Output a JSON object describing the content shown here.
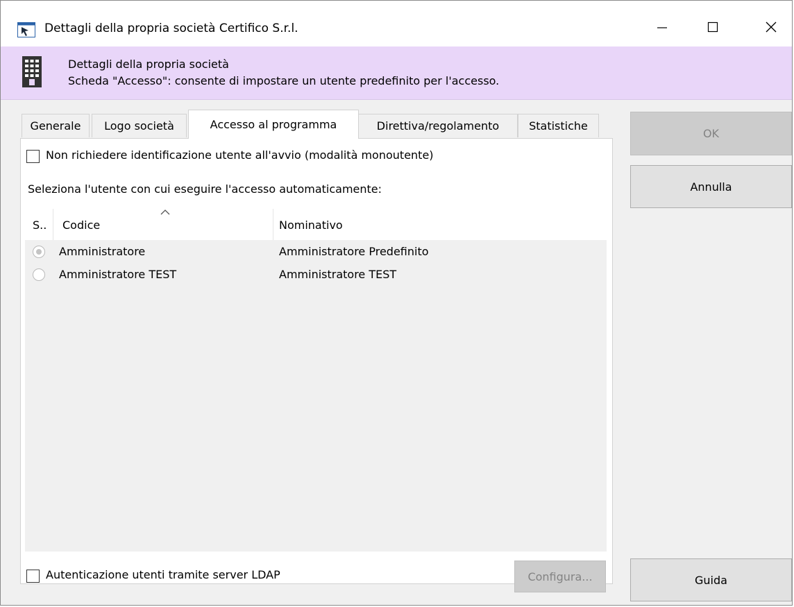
{
  "window": {
    "title": "Dettagli della propria società Certifico S.r.l.",
    "controls": {
      "minimize": "—",
      "maximize": "☐",
      "close": "✕"
    }
  },
  "banner": {
    "heading": "Dettagli della propria società",
    "description": "Scheda \"Accesso\": consente di impostare un utente predefinito per l'accesso.",
    "background": "#e9d6f9"
  },
  "tabs": [
    {
      "label": "Generale"
    },
    {
      "label": "Logo società"
    },
    {
      "label": "Accesso al programma",
      "active": true
    },
    {
      "label": "Direttiva/regolamento"
    },
    {
      "label": "Statistiche"
    }
  ],
  "access": {
    "single_user_label": "Non richiedere identificazione utente all'avvio (modalità monoutente)",
    "single_user_checked": false,
    "select_user_label": "Seleziona l'utente con cui eseguire l'accesso automaticamente:",
    "columns": [
      "S..",
      "Codice",
      "Nominativo"
    ],
    "users": [
      {
        "code": "Amministratore",
        "name": "Amministratore Predefinito",
        "selected": true
      },
      {
        "code": "Amministratore TEST",
        "name": "Amministratore TEST",
        "selected": false
      }
    ],
    "ldap_label": "Autenticazione utenti tramite server LDAP",
    "ldap_checked": false,
    "configure_button": "Configura..."
  },
  "buttons": {
    "ok": "OK",
    "cancel": "Annulla",
    "help": "Guida"
  }
}
